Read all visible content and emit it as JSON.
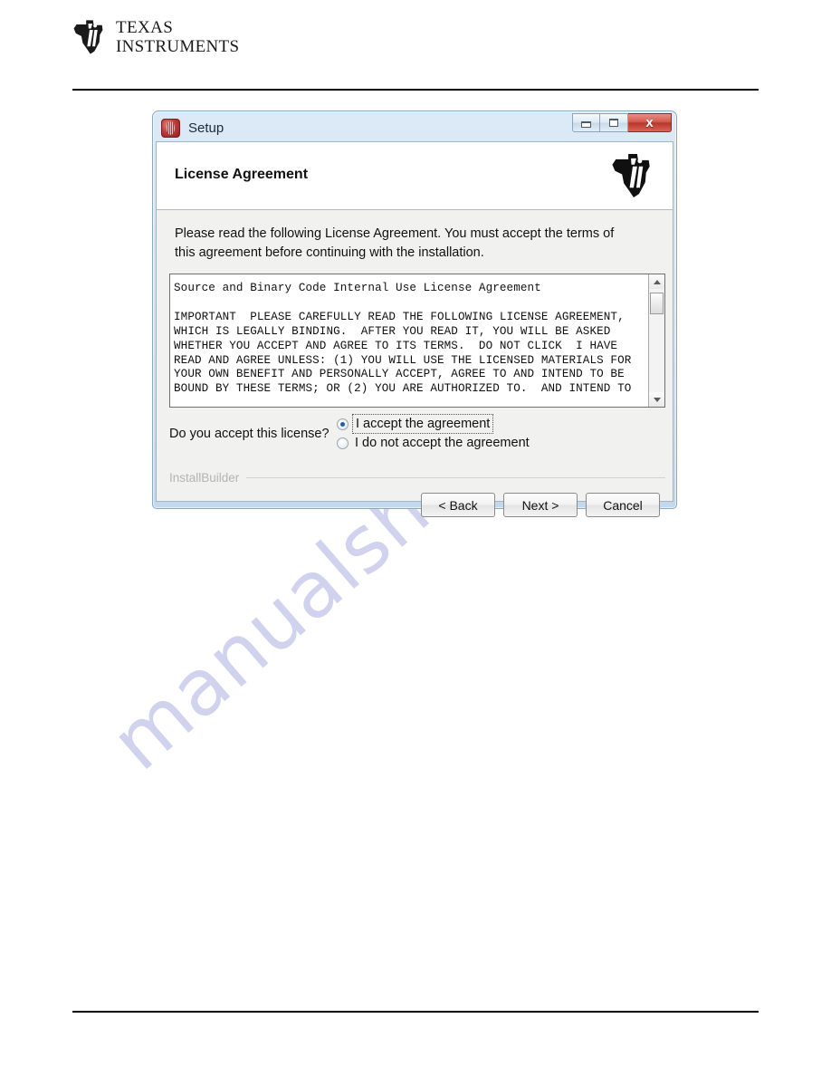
{
  "page": {
    "brand": {
      "line1": "Texas",
      "line2": "Instruments",
      "logo_icon": "ti-texas-logo"
    }
  },
  "dialog": {
    "titlebar": {
      "icon": "setup-app-icon",
      "title": "Setup",
      "minimize_label": "Minimize",
      "maximize_label": "Maximize",
      "close_label": "x"
    },
    "banner": {
      "heading": "License Agreement",
      "logo_icon": "ti-texas-logo"
    },
    "intro": "Please read the following License Agreement. You must accept the terms of this agreement before continuing with the installation.",
    "license_text": "Source and Binary Code Internal Use License Agreement\n\nIMPORTANT  PLEASE CAREFULLY READ THE FOLLOWING LICENSE AGREEMENT,\nWHICH IS LEGALLY BINDING.  AFTER YOU READ IT, YOU WILL BE ASKED\nWHETHER YOU ACCEPT AND AGREE TO ITS TERMS.  DO NOT CLICK  I HAVE\nREAD AND AGREE UNLESS: (1) YOU WILL USE THE LICENSED MATERIALS FOR\nYOUR OWN BENEFIT AND PERSONALLY ACCEPT, AGREE TO AND INTEND TO BE\nBOUND BY THESE TERMS; OR (2) YOU ARE AUTHORIZED TO.  AND INTEND TO",
    "scrollbar": {
      "up_arrow": "scroll-up-icon",
      "down_arrow": "scroll-down-icon"
    },
    "accept": {
      "question": "Do you accept this license?",
      "options": [
        {
          "label": "I accept the agreement",
          "selected": true
        },
        {
          "label": "I do not accept the agreement",
          "selected": false
        }
      ]
    },
    "footer": {
      "branding": "InstallBuilder"
    },
    "buttons": [
      {
        "label": "< Back"
      },
      {
        "label": "Next >"
      },
      {
        "label": "Cancel"
      }
    ]
  },
  "watermark": {
    "text": "manualshive.com",
    "color": "#c9cbea"
  },
  "colors": {
    "titlebar_blue": "#cfe1f2",
    "close_red": "#b8352a",
    "radio_dot_blue": "#1b5fa8",
    "license_border": "#6f6f6f"
  }
}
